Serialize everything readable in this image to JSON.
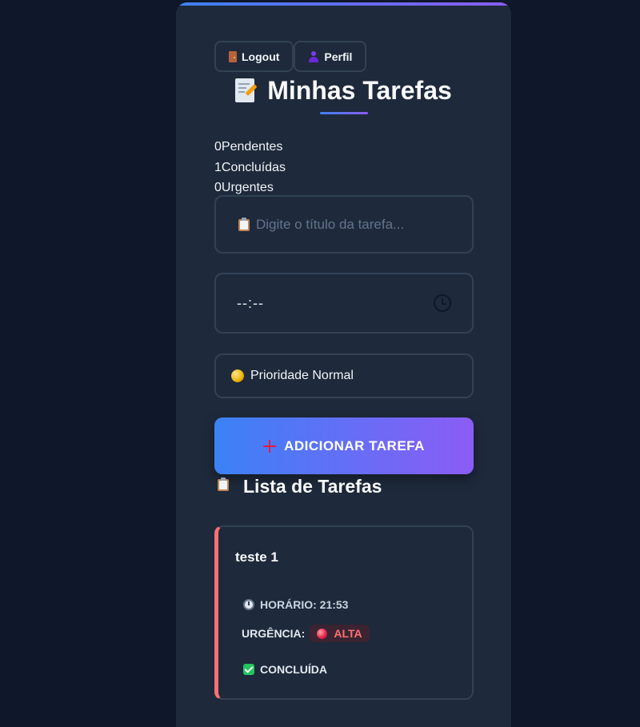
{
  "nav": {
    "logout_label": "Logout",
    "logout_icon": "door-icon",
    "profile_label": "Perfil",
    "profile_icon": "user-icon"
  },
  "header": {
    "title": "Minhas Tarefas",
    "title_icon": "memo-icon"
  },
  "stats": [
    {
      "count": "0",
      "label": "Pendentes"
    },
    {
      "count": "1",
      "label": "Concluídas"
    },
    {
      "count": "0",
      "label": "Urgentes"
    }
  ],
  "form": {
    "title_placeholder": "Digite o título da tarefa...",
    "time_value": "--:--",
    "priority_value": "Prioridade Normal",
    "add_button_label": "ADICIONAR TAREFA"
  },
  "list": {
    "title": "Lista de Tarefas",
    "tasks": [
      {
        "name": "teste 1",
        "time_label": "HORÁRIO: 21:53",
        "urgency_label": "URGÊNCIA:",
        "urgency_value": "ALTA",
        "status": "CONCLUÍDA"
      }
    ]
  },
  "colors": {
    "background": "#0f172a",
    "card": "#1e293b",
    "accent_start": "#3b82f6",
    "accent_end": "#8b5cf6",
    "urgent": "#f87171"
  }
}
